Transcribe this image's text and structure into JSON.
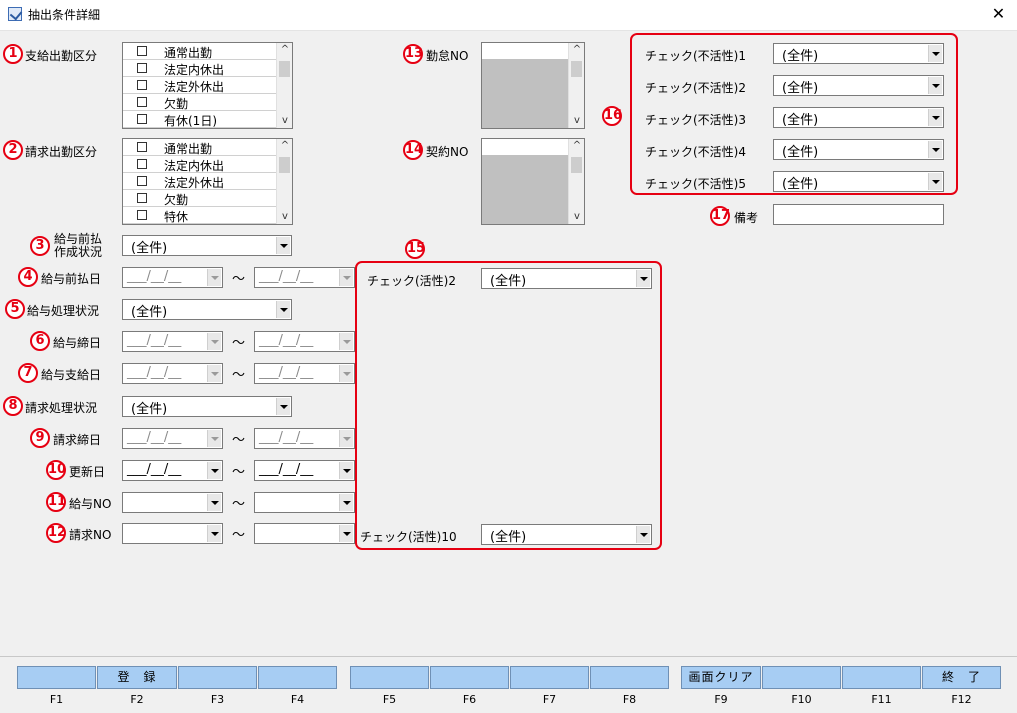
{
  "window": {
    "title": "抽出条件詳細",
    "close_label": "✕"
  },
  "markers": [
    "1",
    "2",
    "3",
    "4",
    "5",
    "6",
    "7",
    "8",
    "9",
    "10",
    "11",
    "12",
    "13",
    "14",
    "15",
    "16",
    "17"
  ],
  "fields": {
    "f1_label": "支給出勤区分",
    "f1_items": [
      "通常出勤",
      "法定内休出",
      "法定外休出",
      "欠勤",
      "有休(1日)"
    ],
    "f2_label": "請求出勤区分",
    "f2_items": [
      "通常出勤",
      "法定内休出",
      "法定外休出",
      "欠勤",
      "特休"
    ],
    "f3_label_line1": "給与前払",
    "f3_label_line2": "作成状況",
    "f3_value": "(全件)",
    "f4_label": "給与前払日",
    "f5_label": "給与処理状況",
    "f5_value": "(全件)",
    "f6_label": "給与締日",
    "f7_label": "給与支給日",
    "f8_label": "請求処理状況",
    "f8_value": "(全件)",
    "f9_label": "請求締日",
    "f10_label": "更新日",
    "f11_label": "給与NO",
    "f12_label": "請求NO",
    "f13_label": "勤怠NO",
    "f14_label": "契約NO",
    "f15_first_label": "チェック(活性)2",
    "f15_first_value": "(全件)",
    "f15_last_label": "チェック(活性)10",
    "f15_last_value": "(全件)",
    "f16_checks": [
      {
        "label": "チェック(不活性)1",
        "value": "(全件)"
      },
      {
        "label": "チェック(不活性)2",
        "value": "(全件)"
      },
      {
        "label": "チェック(不活性)3",
        "value": "(全件)"
      },
      {
        "label": "チェック(不活性)4",
        "value": "(全件)"
      },
      {
        "label": "チェック(不活性)5",
        "value": "(全件)"
      }
    ],
    "f17_label": "備考",
    "f17_value": "",
    "date_placeholder": "___/__/__",
    "tilde": "～"
  },
  "function_keys": [
    {
      "label": "",
      "key": "F1"
    },
    {
      "label": "登　録",
      "key": "F2"
    },
    {
      "label": "",
      "key": "F3"
    },
    {
      "label": "",
      "key": "F4"
    },
    {
      "label": "",
      "key": "F5"
    },
    {
      "label": "",
      "key": "F6"
    },
    {
      "label": "",
      "key": "F7"
    },
    {
      "label": "",
      "key": "F8"
    },
    {
      "label": "画面クリア",
      "key": "F9"
    },
    {
      "label": "",
      "key": "F10"
    },
    {
      "label": "",
      "key": "F11"
    },
    {
      "label": "終　了",
      "key": "F12"
    }
  ],
  "colors": {
    "marker_red": "#e60012",
    "fkey_blue": "#a7cdf3"
  }
}
